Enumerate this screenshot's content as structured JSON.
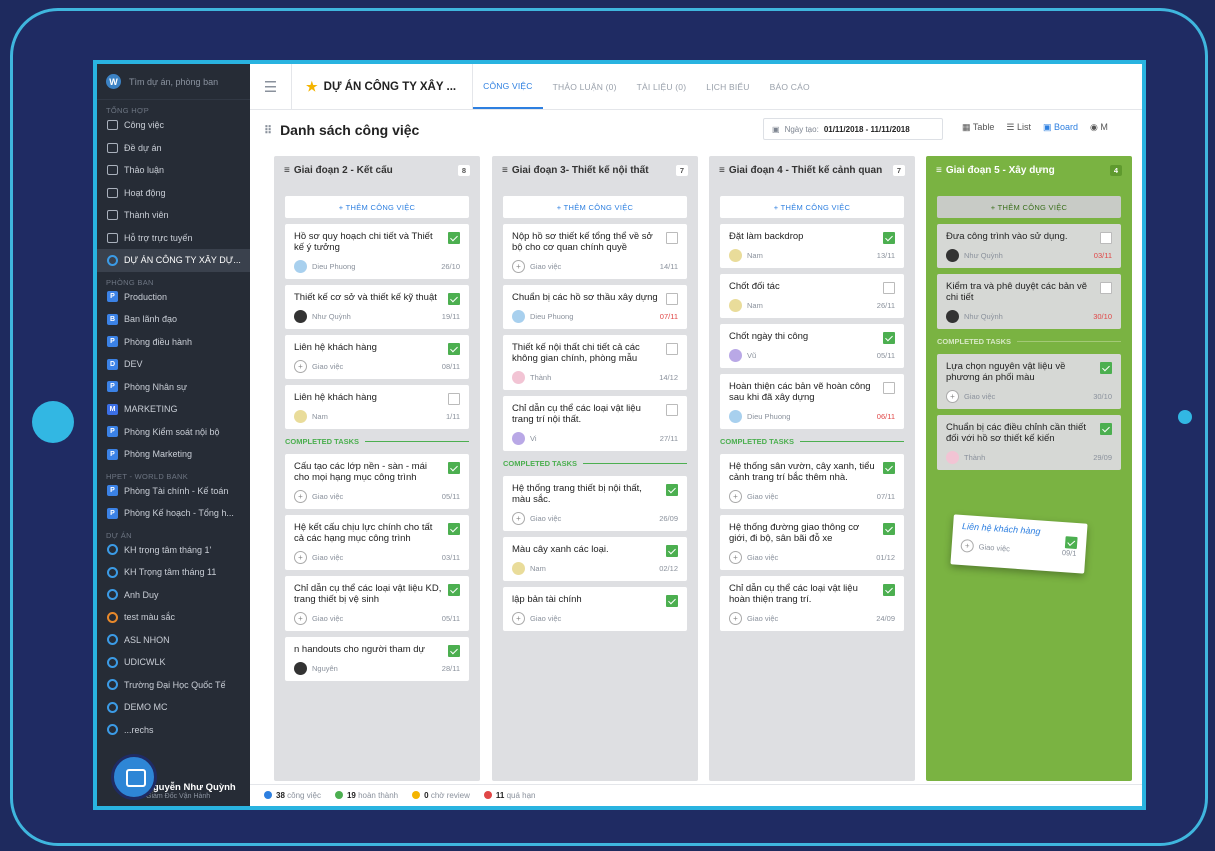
{
  "sidebar": {
    "search": "Tìm dự án, phòng ban",
    "sections": {
      "general": "TỔNG HỢP",
      "depts": "PHÒNG BAN",
      "hpet": "HPET - WORLD BANK",
      "projects": "DỰ ÁN"
    },
    "general": [
      "Công việc",
      "Đề dự án",
      "Thảo luận",
      "Hoạt động",
      "Thành viên",
      "Hỗ trợ trực tuyến",
      "DỰ ÁN CÔNG TY XÂY DỰ..."
    ],
    "depts": [
      {
        "b": "P",
        "l": "Production"
      },
      {
        "b": "B",
        "l": "Ban lãnh đạo"
      },
      {
        "b": "P",
        "l": "Phòng điều hành"
      },
      {
        "b": "D",
        "l": "DEV"
      },
      {
        "b": "P",
        "l": "Phòng Nhân sự"
      },
      {
        "b": "M",
        "l": "MARKETING"
      },
      {
        "b": "P",
        "l": "Phòng Kiểm soát nội bộ"
      },
      {
        "b": "P",
        "l": "Phòng Marketing"
      }
    ],
    "hpet": [
      {
        "b": "P",
        "l": "Phòng Tài chính - Kế toán"
      },
      {
        "b": "P",
        "l": "Phòng Kế hoạch - Tổng h..."
      }
    ],
    "projects": [
      "KH trọng tâm tháng 1'",
      "KH Trọng tâm tháng 11",
      "Anh Duy",
      "test màu sắc",
      "ASL NHON",
      "UDICWLK",
      "Trường Đại Học Quốc Tế",
      "DEMO MC",
      "...rechs"
    ],
    "user": {
      "name": "Nguyễn Như Quỳnh",
      "role": "Giám Đốc Vận Hành"
    }
  },
  "header": {
    "project": "DỰ ÁN CÔNG TY XÂY ...",
    "tabs": [
      "CÔNG VIỆC",
      "THẢO LUẬN (0)",
      "TÀI LIỆU (0)",
      "LỊCH BIỂU",
      "BÁO CÁO"
    ]
  },
  "subbar": {
    "title": "Danh sách công việc",
    "date_label": "Ngày tạo:",
    "date_value": "01/11/2018 - 11/11/2018",
    "views": [
      "Table",
      "List",
      "Board",
      "M"
    ]
  },
  "labels": {
    "add": "+ THÊM CÔNG VIỆC",
    "completed": "COMPLETED TASKS"
  },
  "columns": [
    {
      "title": "Giai đoạn 2 - Kết cấu",
      "count": "8",
      "tasks": [
        {
          "t": "Hồ sơ quy hoạch chi tiết và Thiết kế ý tưởng",
          "who": "Dieu Phuong",
          "due": "26/10",
          "av": "",
          "c": true
        },
        {
          "t": "Thiết kế cơ sở và thiết kế kỹ thuật",
          "who": "Như Quỳnh",
          "due": "19/11",
          "av": "dk",
          "c": true
        },
        {
          "t": "Liên hệ khách hàng",
          "who": "Giao việc",
          "due": "08/11",
          "av": "pl",
          "c": true
        },
        {
          "t": "Liên hệ khách hàng",
          "who": "Nam",
          "due": "1/11",
          "av": "y",
          "c": false
        }
      ],
      "done": [
        {
          "t": "Cấu tạo các lớp nền - sàn - mái cho mọi hạng mục công trình",
          "who": "Giao việc",
          "due": "05/11",
          "av": "pl",
          "c": true
        },
        {
          "t": "Hệ kết cấu chịu lực chính cho tất cả các hạng mục công trình",
          "who": "Giao việc",
          "due": "03/11",
          "av": "pl",
          "c": true
        },
        {
          "t": "Chỉ dẫn cụ thể các loại vật liệu KD, trang thiết bị vệ sinh",
          "who": "Giao việc",
          "due": "05/11",
          "av": "pl",
          "c": true
        },
        {
          "t": "n handouts cho người tham dự",
          "who": "Nguyên",
          "due": "28/11",
          "av": "dk",
          "c": true
        }
      ]
    },
    {
      "title": "Giai đoạn 3- Thiết kế nội thất",
      "count": "7",
      "tasks": [
        {
          "t": "Nộp hồ sơ thiết kế tổng thể về sở bộ cho cơ quan chính quyề",
          "who": "Giao việc",
          "due": "14/11",
          "av": "pl",
          "c": false
        },
        {
          "t": "Chuẩn bị các hồ sơ thầu xây dựng",
          "who": "Dieu Phuong",
          "due": "07/11",
          "av": "",
          "c": false,
          "red": true
        },
        {
          "t": "Thiết kế nội thất chi tiết cả các không gian chính, phòng mẫu",
          "who": "Thành",
          "due": "14/12",
          "av": "pk",
          "c": false
        },
        {
          "t": "Chỉ dẫn cụ thể các loại vật liệu trang trí nội thất.",
          "who": "Vi",
          "due": "27/11",
          "av": "p",
          "c": false
        }
      ],
      "done": [
        {
          "t": "Hệ thống trang thiết bị nội thất, màu sắc.",
          "who": "Giao việc",
          "due": "26/09",
          "av": "pl",
          "c": true
        },
        {
          "t": "Màu cây xanh các loại.",
          "who": "Nam",
          "due": "02/12",
          "av": "y",
          "c": true
        },
        {
          "t": "lập bản tài chính",
          "who": "Giao việc",
          "due": "",
          "av": "pl",
          "c": true
        }
      ]
    },
    {
      "title": "Giai đoạn 4 - Thiết kế cảnh quan",
      "count": "7",
      "tasks": [
        {
          "t": "Đặt làm backdrop",
          "who": "Nam",
          "due": "13/11",
          "av": "y",
          "c": true
        },
        {
          "t": "Chốt đối tác",
          "who": "Nam",
          "due": "26/11",
          "av": "y",
          "c": false
        },
        {
          "t": "Chốt ngày thi công",
          "who": "Vũ",
          "due": "05/11",
          "av": "p",
          "c": true
        },
        {
          "t": "Hoàn thiện các bản vẽ hoàn công sau khi đã xây dựng",
          "who": "Dieu Phuong",
          "due": "06/11",
          "av": "",
          "c": false,
          "red": true
        }
      ],
      "done": [
        {
          "t": "Hệ thống sân vườn, cây xanh, tiểu cảnh trang trí bắc thêm nhà.",
          "who": "Giao việc",
          "due": "07/11",
          "av": "pl",
          "c": true
        },
        {
          "t": "Hệ thống đường giao thông cơ giới, đi bộ, sân bãi đỗ xe",
          "who": "Giao việc",
          "due": "01/12",
          "av": "pl",
          "c": true
        },
        {
          "t": "Chỉ dẫn cụ thể các loại vật liệu hoàn thiện trang trí.",
          "who": "Giao việc",
          "due": "24/09",
          "av": "pl",
          "c": true
        }
      ]
    },
    {
      "title": "Giai đoạn 5 - Xây dựng",
      "count": "4",
      "tasks": [
        {
          "t": "Đưa công trình vào sử dụng.",
          "who": "Như Quỳnh",
          "due": "03/11",
          "av": "dk",
          "c": false,
          "red": true
        },
        {
          "t": "Kiểm tra và phê duyệt các bản vẽ chi tiết",
          "who": "Như Quỳnh",
          "due": "30/10",
          "av": "dk",
          "c": false,
          "red": true
        }
      ],
      "done": [
        {
          "t": "Lựa chọn nguyên vật liệu về phương án phối màu",
          "who": "Giao việc",
          "due": "30/10",
          "av": "pl",
          "c": true
        },
        {
          "t": "Chuẩn bị các điều chỉnh cần thiết đối với hồ sơ thiết kế kiến",
          "who": "Thành",
          "due": "29/09",
          "av": "pk",
          "c": true
        }
      ]
    }
  ],
  "dragging": {
    "t": "Liên hệ khách hàng",
    "who": "Giao việc",
    "due": "09/1"
  },
  "footer": {
    "tasks": "38",
    "tasks_l": "công việc",
    "done": "19",
    "done_l": "hoàn thành",
    "review": "0",
    "review_l": "chờ review",
    "overdue": "11",
    "overdue_l": "quá hạn"
  }
}
